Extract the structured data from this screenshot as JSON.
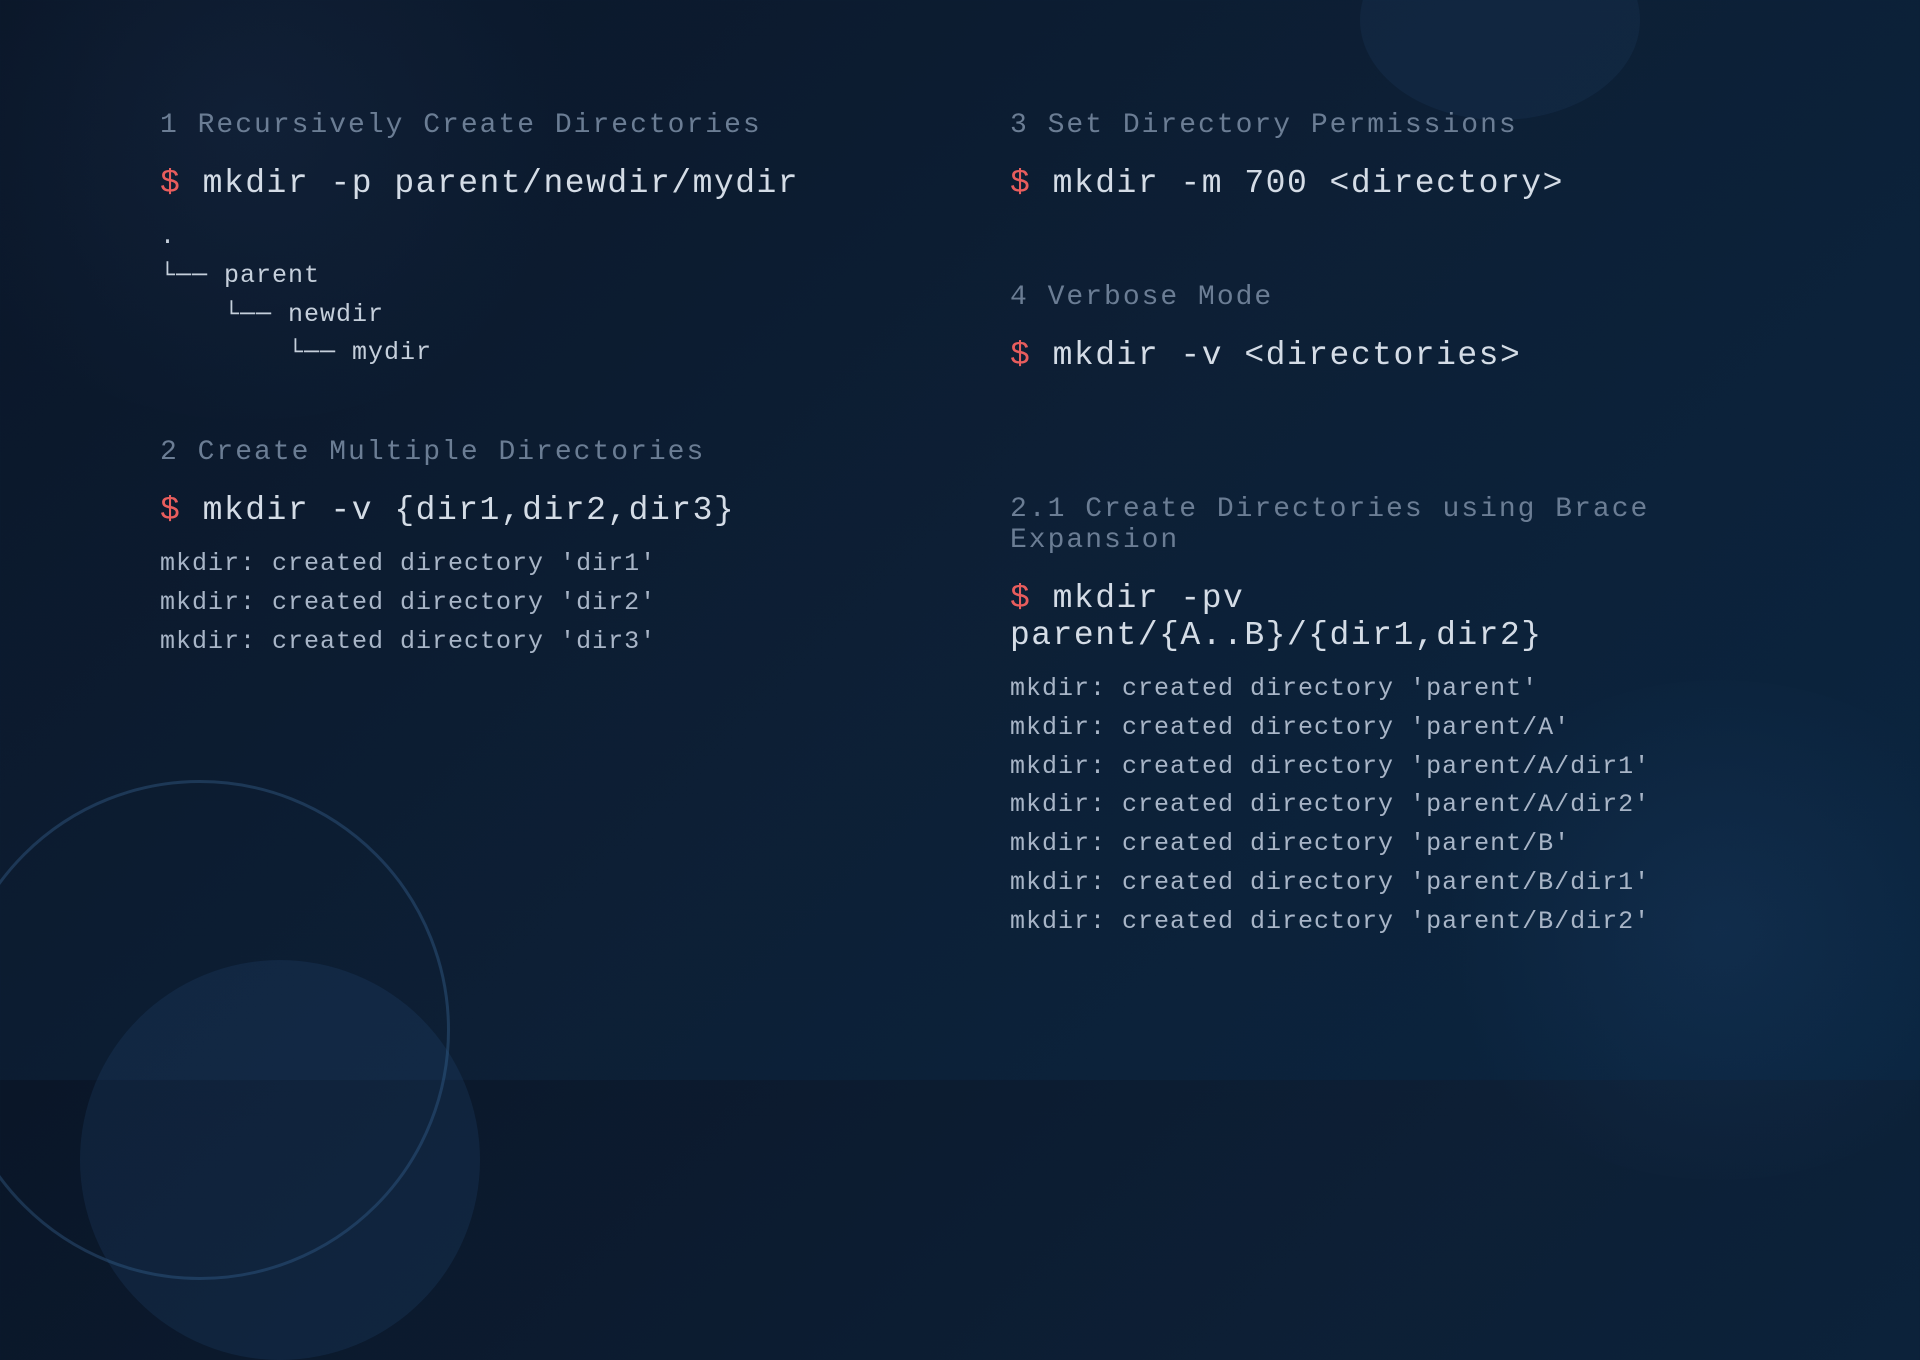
{
  "sections": {
    "s1": {
      "heading": "1 Recursively Create Directories",
      "prompt": "$",
      "cmd": " mkdir -p parent/newdir/mydir",
      "tree": ".\n└── parent\n    └── newdir\n        └── mydir"
    },
    "s2": {
      "heading": "2 Create Multiple Directories",
      "prompt": "$",
      "cmd": " mkdir -v {dir1,dir2,dir3}",
      "output": "mkdir: created directory 'dir1'\nmkdir: created directory 'dir2'\nmkdir: created directory 'dir3'"
    },
    "s3": {
      "heading": "3 Set Directory Permissions",
      "prompt": "$",
      "cmd": " mkdir -m 700 <directory>"
    },
    "s4": {
      "heading": "4 Verbose Mode",
      "prompt": "$",
      "cmd": " mkdir -v <directories>"
    },
    "s21": {
      "heading": "2.1 Create Directories using Brace Expansion",
      "prompt": "$",
      "cmd": " mkdir -pv parent/{A..B}/{dir1,dir2}",
      "output": "mkdir: created directory 'parent'\nmkdir: created directory 'parent/A'\nmkdir: created directory 'parent/A/dir1'\nmkdir: created directory 'parent/A/dir2'\nmkdir: created directory 'parent/B'\nmkdir: created directory 'parent/B/dir1'\nmkdir: created directory 'parent/B/dir2'"
    }
  }
}
